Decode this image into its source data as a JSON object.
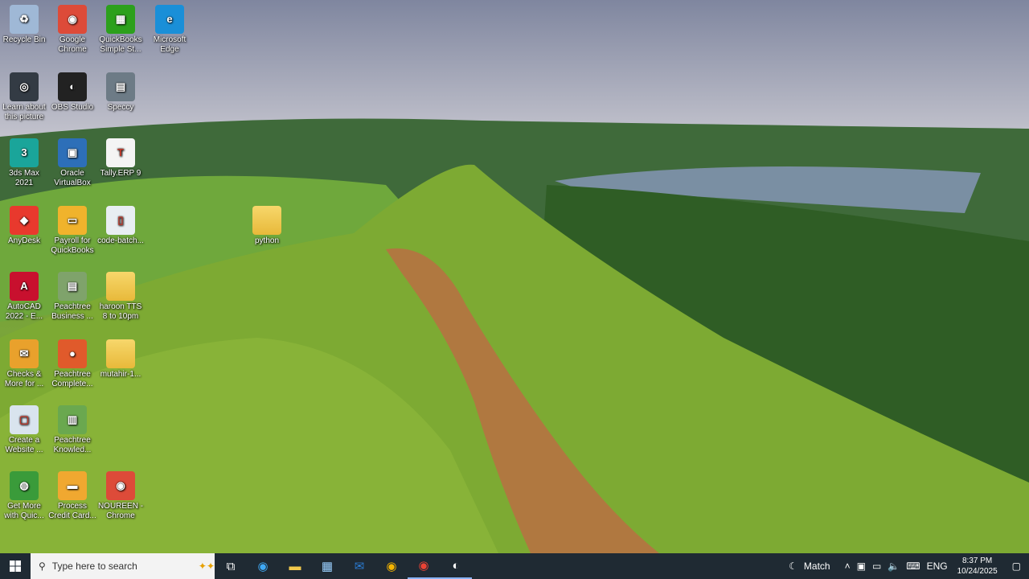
{
  "desktop": {
    "icons": [
      {
        "label": "Recycle Bin",
        "icon": "recycle-bin-icon",
        "color": "#9fb8d6",
        "glyph": "♻"
      },
      {
        "label": "Google Chrome",
        "icon": "chrome-icon",
        "color": "#dd4b39",
        "glyph": "◉"
      },
      {
        "label": "QuickBooks Simple St...",
        "icon": "quickbooks-icon",
        "color": "#2ca01c",
        "glyph": "▦"
      },
      {
        "label": "Microsoft Edge",
        "icon": "edge-icon",
        "color": "#1a8fd8",
        "glyph": "e"
      },
      {
        "label": "Learn about this picture",
        "icon": "learn-picture-icon",
        "color": "#333b44",
        "glyph": "◎"
      },
      {
        "label": "OBS Studio",
        "icon": "obs-icon",
        "color": "#222",
        "glyph": "◐"
      },
      {
        "label": "Speccy",
        "icon": "speccy-icon",
        "color": "#6d7b86",
        "glyph": "▤"
      },
      {
        "label": "3ds Max 2021",
        "icon": "3ds-max-icon",
        "color": "#1aa59a",
        "glyph": "3"
      },
      {
        "label": "Oracle VirtualBox",
        "icon": "virtualbox-icon",
        "color": "#2d6fb8",
        "glyph": "▣"
      },
      {
        "label": "Tally.ERP 9",
        "icon": "tally-icon",
        "color": "#f4f4f4",
        "glyph": "T"
      },
      {
        "label": "AnyDesk",
        "icon": "anydesk-icon",
        "color": "#e8392d",
        "glyph": "◆"
      },
      {
        "label": "Payroll for QuickBooks",
        "icon": "payroll-icon",
        "color": "#f0b32c",
        "glyph": "▭"
      },
      {
        "label": "code-batch...",
        "icon": "file-icon",
        "color": "#e8eef2",
        "glyph": "▯"
      },
      {
        "label": "python",
        "icon": "folder-icon",
        "color": "#f2c94c",
        "glyph": ""
      },
      {
        "label": "AutoCAD 2022 - E...",
        "icon": "autocad-icon",
        "color": "#c8102e",
        "glyph": "A"
      },
      {
        "label": "Peachtree Business ...",
        "icon": "peachtree-icon",
        "color": "#7fa36b",
        "glyph": "▤"
      },
      {
        "label": "haroon TTS 8 to 10pm",
        "icon": "folder-icon",
        "color": "#f2c94c",
        "glyph": ""
      },
      {
        "label": "Checks & More for ...",
        "icon": "checks-icon",
        "color": "#e9a12c",
        "glyph": "✉"
      },
      {
        "label": "Peachtree Complete...",
        "icon": "peachtree-complete-icon",
        "color": "#e05a2b",
        "glyph": "●"
      },
      {
        "label": "mutahir-1...",
        "icon": "folder-icon",
        "color": "#f2c94c",
        "glyph": ""
      },
      {
        "label": "Create a Website ...",
        "icon": "create-website-icon",
        "color": "#d9e4ee",
        "glyph": "▢"
      },
      {
        "label": "Peachtree Knowled...",
        "icon": "knowledge-icon",
        "color": "#6aa84f",
        "glyph": "▥"
      },
      {
        "label": "Get More with Quic...",
        "icon": "get-more-icon",
        "color": "#3a9b3a",
        "glyph": "◍"
      },
      {
        "label": "Process Credit Card...",
        "icon": "credit-card-icon",
        "color": "#f0a830",
        "glyph": "▬"
      },
      {
        "label": "NOUREEN - Chrome",
        "icon": "chrome-profile-icon",
        "color": "#dd4b39",
        "glyph": "◉"
      }
    ]
  },
  "taskbar": {
    "search_placeholder": "Type here to search",
    "weather_label": "Match",
    "language": "ENG",
    "time": "8:37 PM",
    "date": "10/24/2025"
  }
}
